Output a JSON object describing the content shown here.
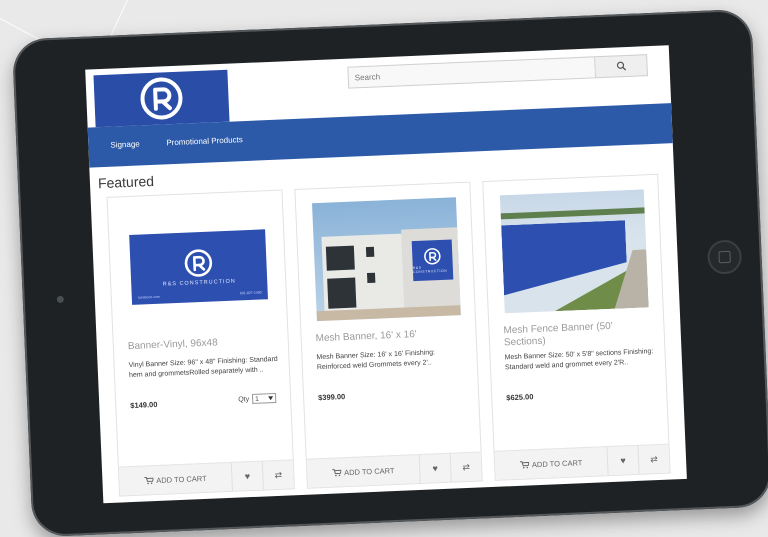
{
  "header": {
    "search": {
      "placeholder": "Search"
    }
  },
  "nav": {
    "items": [
      {
        "label": "Signage"
      },
      {
        "label": "Promotional Products"
      }
    ]
  },
  "featured": {
    "heading": "Featured"
  },
  "products": [
    {
      "title": "Banner-Vinyl, 96x48",
      "description": "Vinyl Banner Size: 96\" x 48\" Finishing: Standard hem and grommetsRolled separately with ..",
      "price": "$149.00",
      "qty_label": "Qty",
      "qty_value": "1",
      "sign_company": "R&S CONSTRUCTION",
      "sign_site": "randscon.com",
      "sign_phone": "601-827-1400"
    },
    {
      "title": "Mesh Banner, 16' x 16'",
      "description": "Mesh Banner Size: 16' x 16' Finishing: Reinforced weld Grommets every 2'..",
      "price": "$399.00",
      "sign_company": "R&S CONSTRUCTION"
    },
    {
      "title": "Mesh Fence Banner (50' Sections)",
      "description": "Mesh Banner Size: 50' x 5'8\" sections Finishing: Standard weld and grommet every 2'R..",
      "price": "$625.00"
    }
  ],
  "actions": {
    "add_to_cart": "ADD TO CART"
  },
  "colors": {
    "brand_blue": "#2c5aa8",
    "logo_blue": "#2a4ea8"
  },
  "icons": [
    "search-icon",
    "cart-icon",
    "heart-icon",
    "compare-icon",
    "chevron-down-icon",
    "logo-r-icon"
  ]
}
